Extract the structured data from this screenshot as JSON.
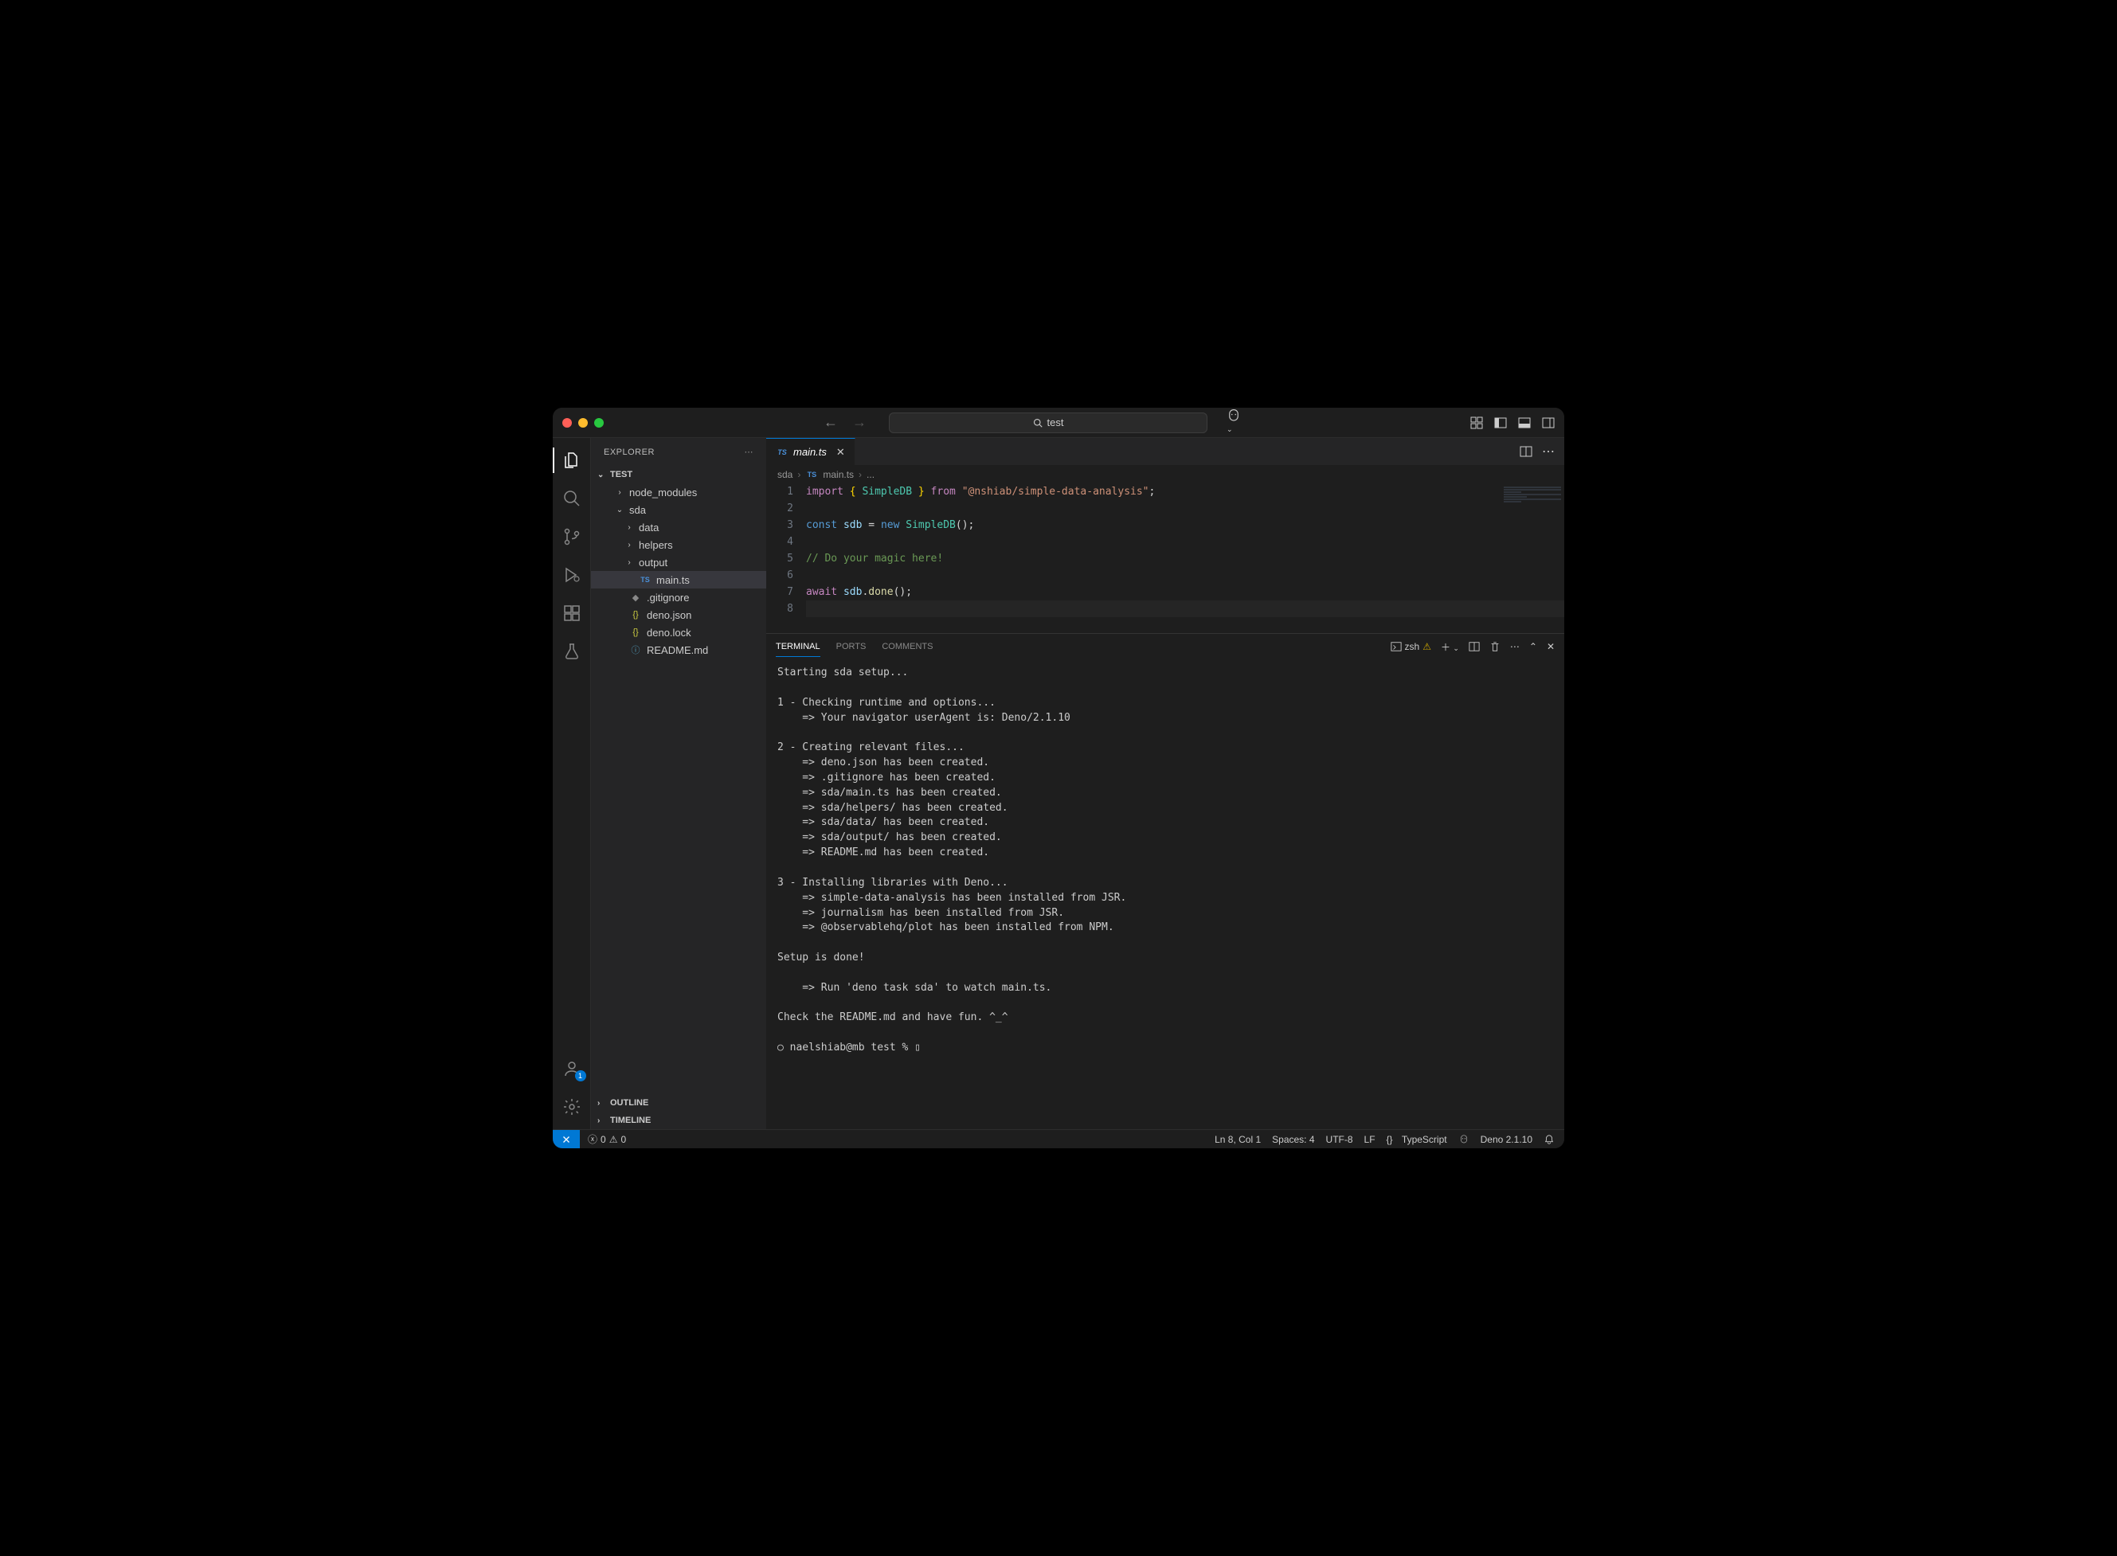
{
  "titlebar": {
    "search_text": "test"
  },
  "sidebar": {
    "title": "EXPLORER",
    "project": "TEST",
    "tree": {
      "node_modules": "node_modules",
      "sda": "sda",
      "data": "data",
      "helpers": "helpers",
      "output": "output",
      "main_ts": "main.ts",
      "gitignore": ".gitignore",
      "deno_json": "deno.json",
      "deno_lock": "deno.lock",
      "readme": "README.md"
    },
    "outline": "OUTLINE",
    "timeline": "TIMELINE"
  },
  "editor": {
    "tab_label": "main.ts",
    "breadcrumb": {
      "a": "sda",
      "b": "main.ts",
      "c": "..."
    },
    "lines": {
      "l1_import": "import",
      "l1_brace_open": "{",
      "l1_simple": " SimpleDB ",
      "l1_brace_close": "}",
      "l1_from": " from ",
      "l1_str": "\"@nshiab/simple-data-analysis\"",
      "l1_semi": ";",
      "l3_const": "const ",
      "l3_sdb": "sdb",
      "l3_eq": " = ",
      "l3_new": "new ",
      "l3_cls": "SimpleDB",
      "l3_paren": "();",
      "l5_comment": "// Do your magic here!",
      "l7_await": "await ",
      "l7_sdb": "sdb",
      "l7_dot": ".",
      "l7_done": "done",
      "l7_paren": "();"
    },
    "line_numbers": [
      "1",
      "2",
      "3",
      "4",
      "5",
      "6",
      "7",
      "8"
    ]
  },
  "panel": {
    "tabs": {
      "terminal": "TERMINAL",
      "ports": "PORTS",
      "comments": "COMMENTS"
    },
    "shell": "zsh",
    "terminal_output": "Starting sda setup...\n\n1 - Checking runtime and options...\n    => Your navigator userAgent is: Deno/2.1.10\n\n2 - Creating relevant files...\n    => deno.json has been created.\n    => .gitignore has been created.\n    => sda/main.ts has been created.\n    => sda/helpers/ has been created.\n    => sda/data/ has been created.\n    => sda/output/ has been created.\n    => README.md has been created.\n\n3 - Installing libraries with Deno...\n    => simple-data-analysis has been installed from JSR.\n    => journalism has been installed from JSR.\n    => @observablehq/plot has been installed from NPM.\n\nSetup is done!\n\n    => Run 'deno task sda' to watch main.ts.\n\nCheck the README.md and have fun. ^_^\n\n○ naelshiab@mb test % ▯"
  },
  "statusbar": {
    "errors": "0",
    "warnings": "0",
    "cursor": "Ln 8, Col 1",
    "spaces": "Spaces: 4",
    "encoding": "UTF-8",
    "eol": "LF",
    "language": "TypeScript",
    "runtime": "Deno 2.1.10"
  },
  "activity": {
    "account_badge": "1"
  }
}
